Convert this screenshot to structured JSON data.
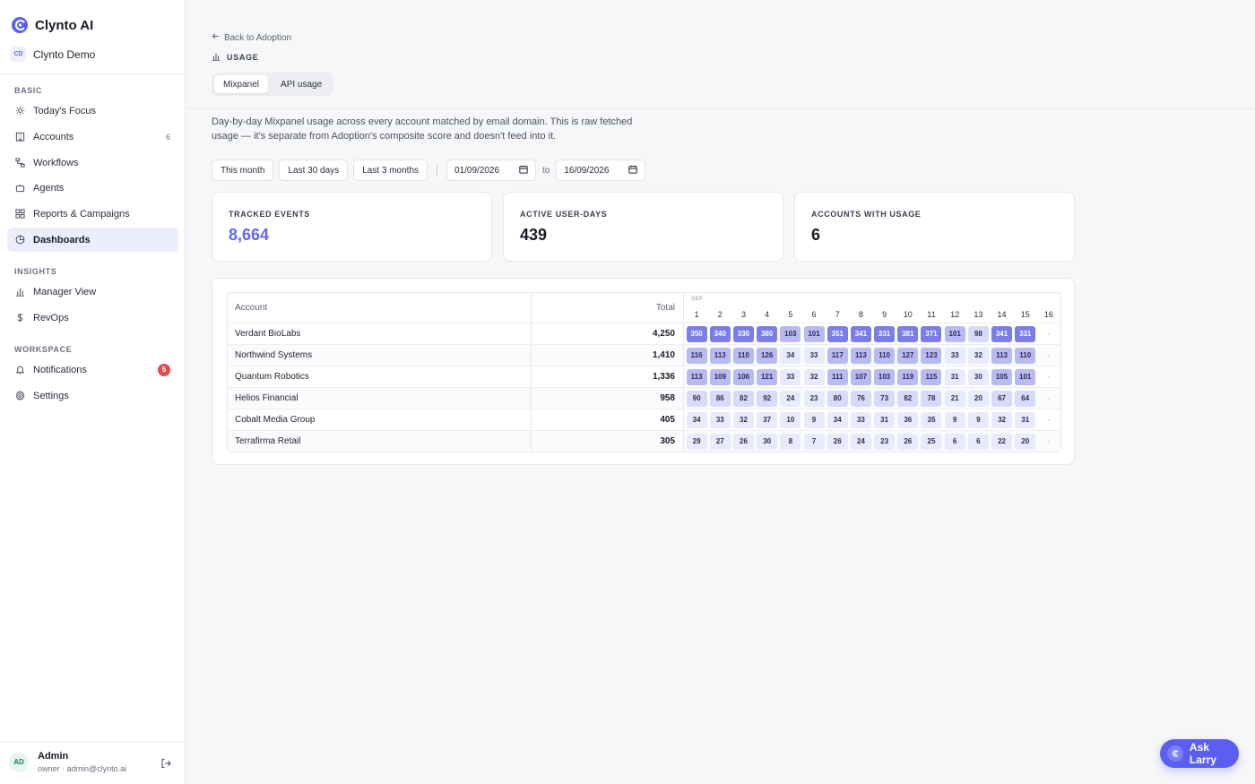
{
  "brand": {
    "name": "Clynto AI",
    "org_initials": "CD",
    "org_name": "Clynto Demo"
  },
  "sidebar": {
    "sections": {
      "basic": "BASIC",
      "insights": "INSIGHTS",
      "workspace": "WORKSPACE"
    },
    "items": [
      {
        "label": "Today's Focus",
        "icon": "sun-icon"
      },
      {
        "label": "Accounts",
        "icon": "building-icon",
        "count": "6"
      },
      {
        "label": "Workflows",
        "icon": "workflow-icon"
      },
      {
        "label": "Agents",
        "icon": "bot-icon"
      },
      {
        "label": "Reports & Campaigns",
        "icon": "grid-icon"
      },
      {
        "label": "Dashboards",
        "icon": "pie-chart-icon",
        "active": true
      },
      {
        "label": "Manager View",
        "icon": "bar-chart-icon"
      },
      {
        "label": "RevOps",
        "icon": "dollar-icon"
      },
      {
        "label": "Notifications",
        "icon": "bell-icon",
        "badge": "5"
      },
      {
        "label": "Settings",
        "icon": "gear-icon"
      }
    ],
    "user": {
      "initials": "AD",
      "name": "Admin",
      "meta": "owner · admin@clynto.ai"
    }
  },
  "header": {
    "back": "Back to Adoption",
    "eyebrow": "USAGE",
    "tabs": [
      "Mixpanel",
      "API usage"
    ]
  },
  "description": "Day-by-day Mixpanel usage across every account matched by email domain. This is raw fetched usage — it's separate from Adoption's composite score and doesn't feed into it.",
  "filters": {
    "this_month": "This month",
    "last_30": "Last 30 days",
    "last_3m": "Last 3 months",
    "from": "01/09/2026",
    "to_label": "to",
    "to": "16/09/2026"
  },
  "stats": [
    {
      "label": "TRACKED EVENTS",
      "value": "8,664"
    },
    {
      "label": "ACTIVE USER-DAYS",
      "value": "439"
    },
    {
      "label": "ACCOUNTS WITH USAGE",
      "value": "6"
    }
  ],
  "table": {
    "col_account": "Account",
    "col_total": "Total",
    "month": "SEP",
    "days": [
      "1",
      "2",
      "3",
      "4",
      "5",
      "6",
      "7",
      "8",
      "9",
      "10",
      "11",
      "12",
      "13",
      "14",
      "15",
      "16"
    ],
    "rows": [
      {
        "account": "Verdant BioLabs",
        "total": "4,250",
        "values": [
          350,
          340,
          330,
          380,
          103,
          101,
          351,
          341,
          331,
          381,
          371,
          101,
          98,
          341,
          331,
          null
        ]
      },
      {
        "account": "Northwind Systems",
        "total": "1,410",
        "values": [
          116,
          113,
          110,
          126,
          34,
          33,
          117,
          113,
          110,
          127,
          123,
          33,
          32,
          113,
          110,
          null
        ]
      },
      {
        "account": "Quantum Robotics",
        "total": "1,336",
        "values": [
          113,
          109,
          106,
          121,
          33,
          32,
          111,
          107,
          103,
          119,
          115,
          31,
          30,
          105,
          101,
          null
        ]
      },
      {
        "account": "Helios Financial",
        "total": "958",
        "values": [
          90,
          86,
          82,
          92,
          24,
          23,
          80,
          76,
          73,
          82,
          78,
          21,
          20,
          67,
          64,
          null
        ]
      },
      {
        "account": "Cobalt Media Group",
        "total": "405",
        "values": [
          34,
          33,
          32,
          37,
          10,
          9,
          34,
          33,
          31,
          36,
          35,
          9,
          9,
          32,
          31,
          null
        ]
      },
      {
        "account": "Terrafirma Retail",
        "total": "305",
        "values": [
          29,
          27,
          26,
          30,
          8,
          7,
          26,
          24,
          23,
          26,
          25,
          6,
          6,
          22,
          20,
          null
        ]
      }
    ],
    "empty_symbol": "-"
  },
  "ask": {
    "label": "Ask Larry"
  },
  "colors": {
    "accent": "#6366f1",
    "heat_high": "#7b7ee8",
    "heat_mid": "#b8baf1",
    "heat_low": "#d9daf7",
    "badge": "#e5484d"
  }
}
